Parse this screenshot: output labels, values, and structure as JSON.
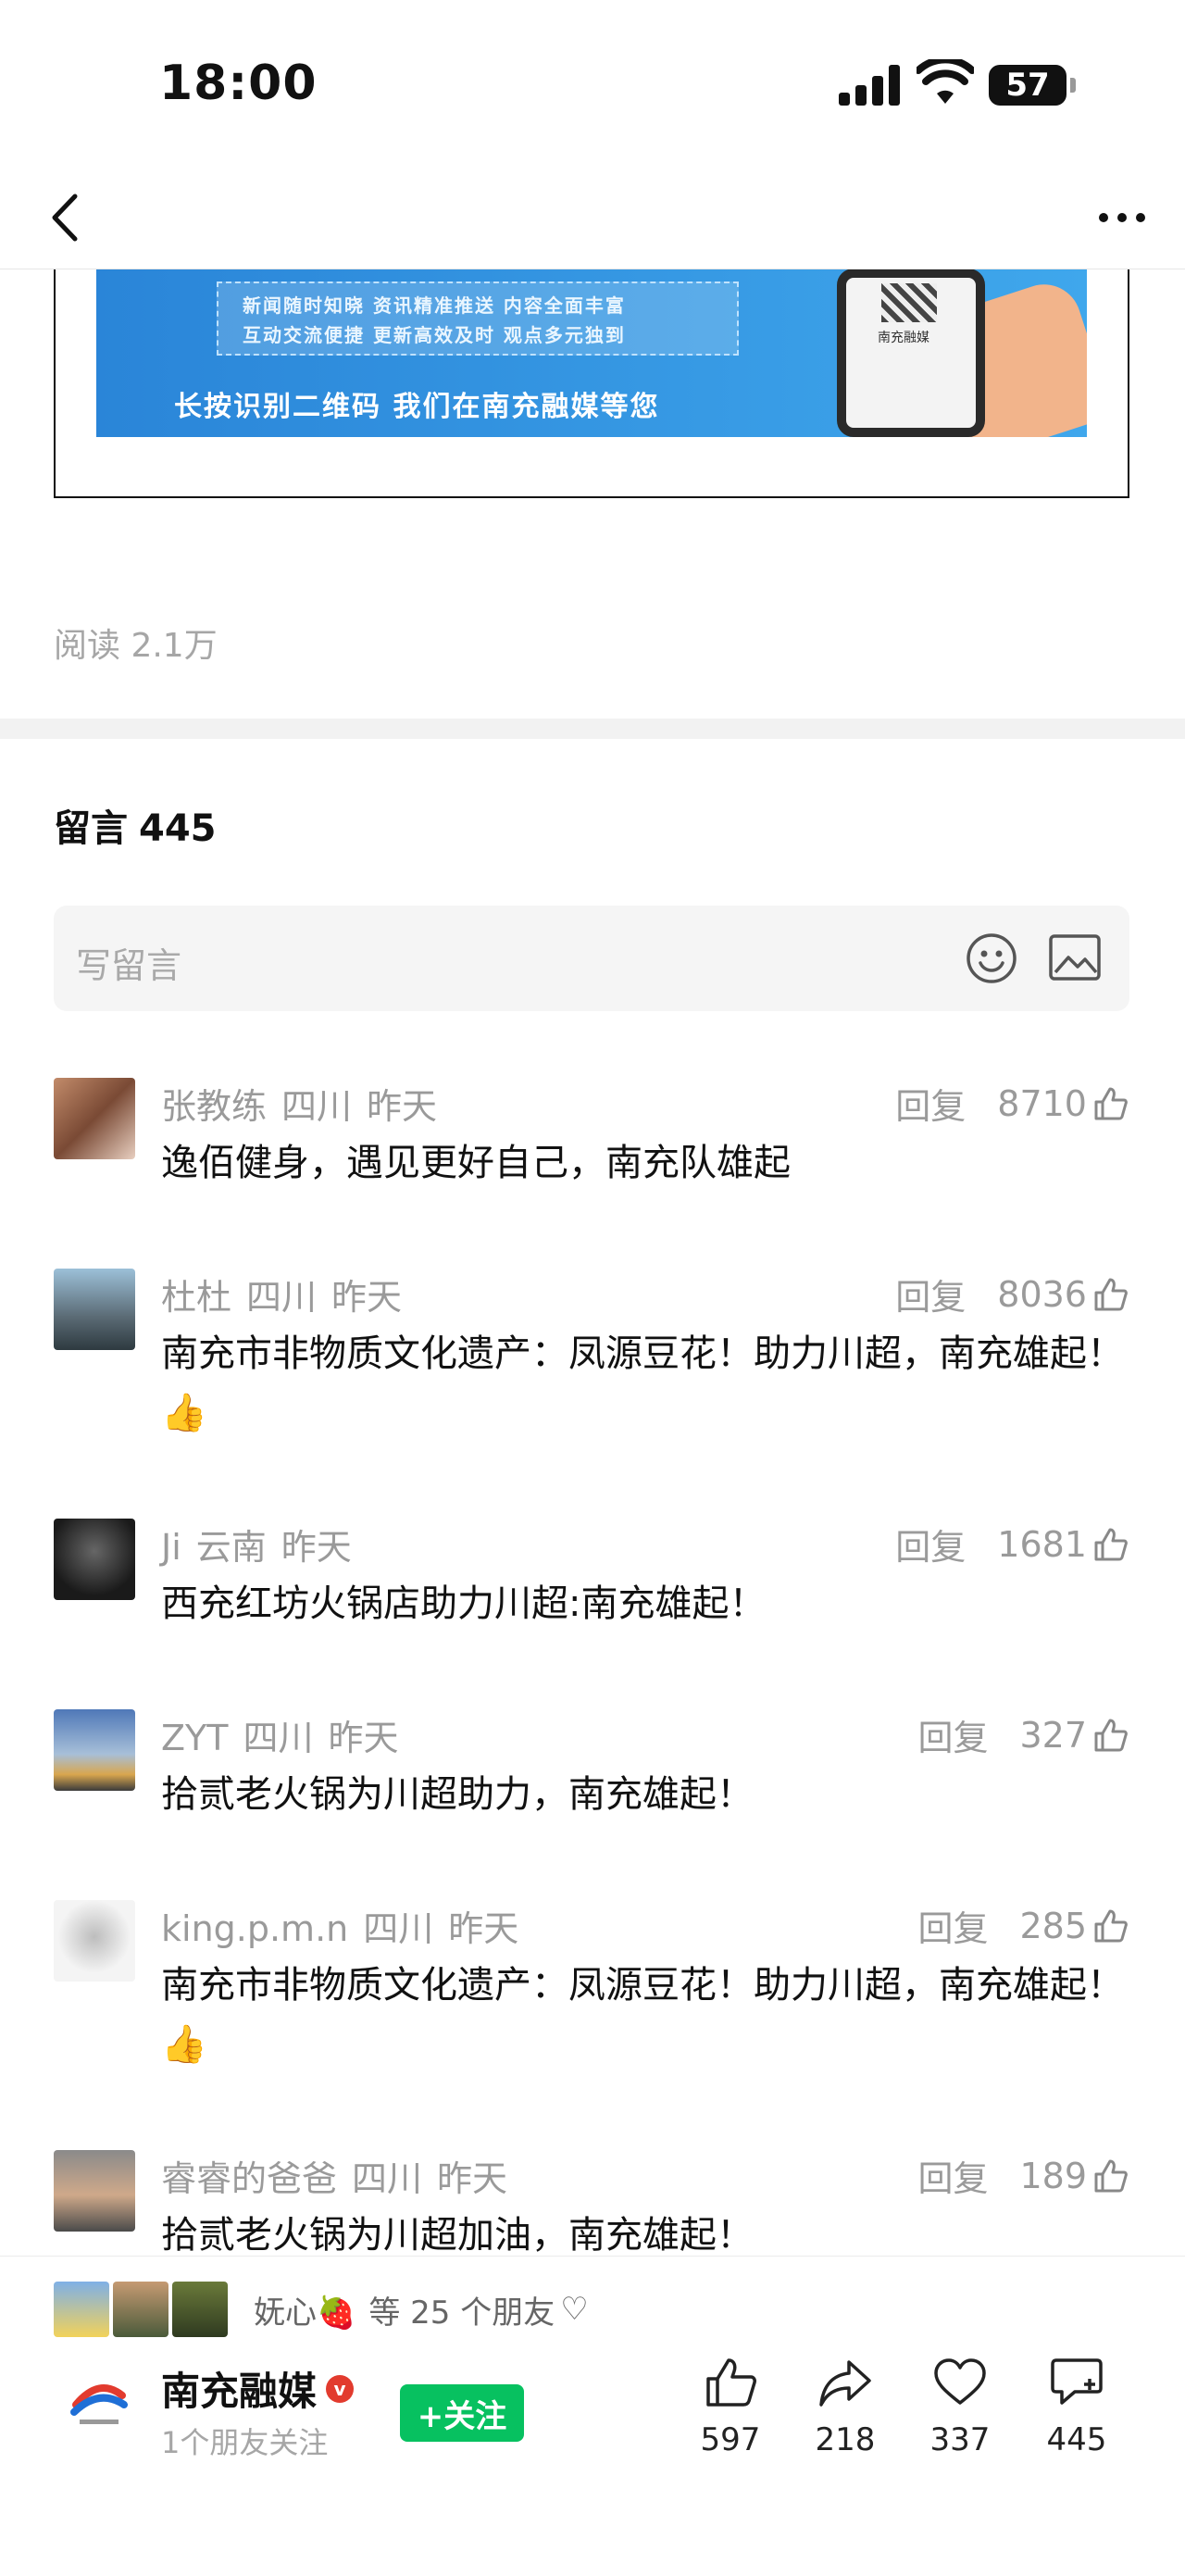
{
  "status": {
    "time": "18:00",
    "battery": "57"
  },
  "banner": {
    "line1": "新闻随时知晓  资讯精准推送  内容全面丰富",
    "line2": "互动交流便捷  更新高效及时  观点多元独到",
    "main": "长按识别二维码  我们在南充融媒等您",
    "qr_label": "南充融媒"
  },
  "article": {
    "read_label": "阅读 2.1万"
  },
  "comments_header": {
    "label": "留言",
    "count": "445"
  },
  "comment_input": {
    "placeholder": "写留言"
  },
  "comments": [
    {
      "name": "张教练",
      "location": "四川",
      "time": "昨天",
      "reply": "回复",
      "likes": "8710",
      "text": "逸佰健身，遇见更好自己，南充队雄起"
    },
    {
      "name": "杜杜",
      "location": "四川",
      "time": "昨天",
      "reply": "回复",
      "likes": "8036",
      "text": "南充市非物质文化遗产：凤源豆花！助力川超，南充雄起！👍"
    },
    {
      "name": "Ji",
      "location": "云南",
      "time": "昨天",
      "reply": "回复",
      "likes": "1681",
      "text": "西充红坊火锅店助力川超:南充雄起！"
    },
    {
      "name": "ZYT",
      "location": "四川",
      "time": "昨天",
      "reply": "回复",
      "likes": "327",
      "text": "拾贰老火锅为川超助力，南充雄起！"
    },
    {
      "name": "king.p.m.n",
      "location": "四川",
      "time": "昨天",
      "reply": "回复",
      "likes": "285",
      "text": "南充市非物质文化遗产：凤源豆花！助力川超，南充雄起！👍"
    },
    {
      "name": "睿睿的爸爸",
      "location": "四川",
      "time": "昨天",
      "reply": "回复",
      "likes": "189",
      "text": "拾贰老火锅为川超加油，南充雄起！"
    }
  ],
  "friends": {
    "name": "妩心🍓",
    "text": "等 25 个朋友",
    "heart": "♡"
  },
  "account": {
    "name": "南充融媒",
    "verified": "v",
    "followers": "1个朋友关注",
    "follow_label": "+关注"
  },
  "toolbar": {
    "like": "597",
    "share": "218",
    "love": "337",
    "comment": "445"
  },
  "colors": {
    "accent_green": "#07c160",
    "muted_gray": "#9a9a9a",
    "banner_blue": "#2a85d8"
  }
}
